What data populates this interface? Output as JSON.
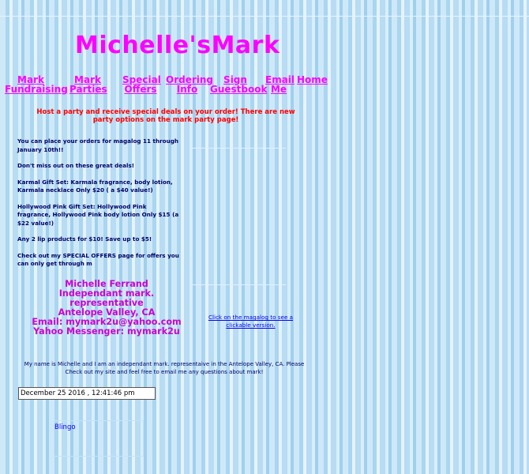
{
  "site_title": "Michelle'sMark",
  "nav": [
    {
      "label": "Mark\nFundraising"
    },
    {
      "label": "Mark\nParties"
    },
    {
      "label": "Special\nOffers"
    },
    {
      "label": "Ordering\nInfo"
    },
    {
      "label": "Sign\nGuestbook"
    },
    {
      "label": "Email\nMe"
    },
    {
      "label": "Home"
    }
  ],
  "promo": "Host a party and receive special deals on your order! There are new party options on the mark party page!",
  "news": [
    "You can place your orders for magalog 11 through January 10th!!",
    "Don't miss out on these great deals!",
    "Karmal Gift Set: Karmala fragrance, body lotion, Karmala necklace  Only $20 ( a $40 value!)",
    "Hollywood Pink Gift Set: Hollywood Pink fragrance, Hollywood Pink body lotion Only $15 (a $22 value!)",
    "Any 2 lip products for $10! Save up to $5!",
    "Check out my SPECIAL OFFERS page for offers you can only get through m"
  ],
  "contact": {
    "name": "Michelle Ferrand",
    "title": "Independant mark. representative",
    "location": "Antelope Valley, CA",
    "email": "Email: mymark2u@yahoo.com",
    "messenger": "Yahoo Messenger: mymark2u"
  },
  "magalog_link": "Click on the magalog to see a clickable version.",
  "about": "My name is Michelle and I am an independant mark. representaive in the Antelope Valley, CA. Please Check out my site and feel free to email me any questions about mark!",
  "datetime": "December 25 2016 , 12:41:46 pm",
  "widget_label": "Blingo",
  "colors": {
    "title": "#ff00ff",
    "promo": "#ff0000",
    "contact": "#cc00cc",
    "link": "#0000ee"
  }
}
